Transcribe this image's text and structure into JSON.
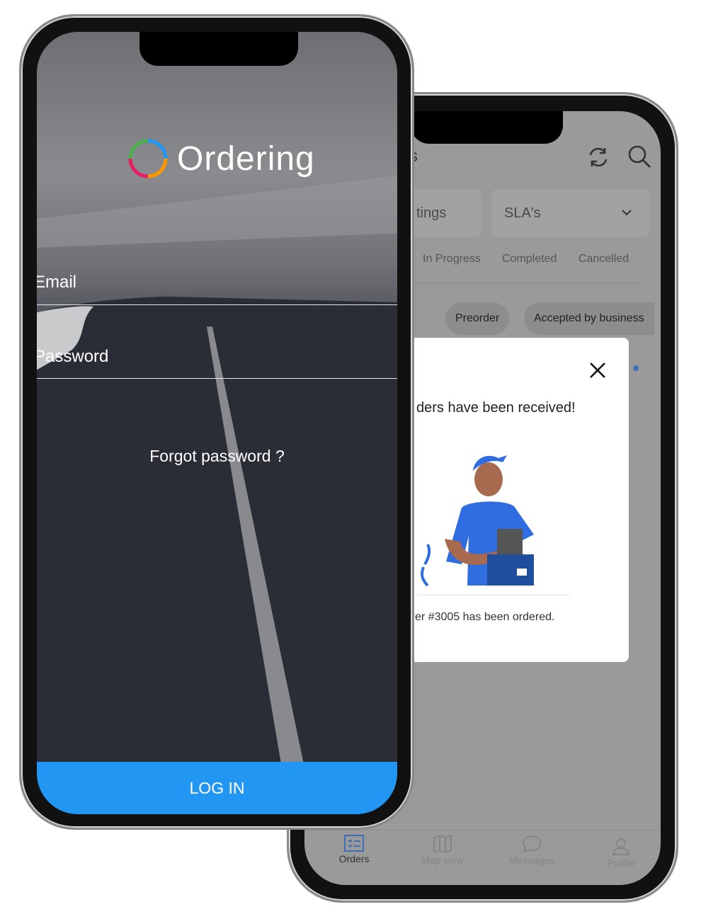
{
  "back_phone": {
    "header_fragment": "s",
    "filters": {
      "left_fragment": "tings",
      "sla_select": "SLA's"
    },
    "tabs": [
      "In Progress",
      "Completed",
      "Cancelled"
    ],
    "chips": [
      "Preorder",
      "Accepted by business"
    ],
    "modal": {
      "title": "ders have been received!",
      "message": "er #3005 has been ordered."
    },
    "bottom_nav": [
      {
        "label": "Orders",
        "icon": "orders-list-icon",
        "active": true
      },
      {
        "label": "Map view",
        "icon": "map-icon",
        "active": false
      },
      {
        "label": "Messages",
        "icon": "chat-bubble-icon",
        "active": false
      },
      {
        "label": "Profile",
        "icon": "user-icon",
        "active": false
      }
    ],
    "accent_color": "#3d6fb6"
  },
  "front_phone": {
    "logo_text": "Ordering",
    "email_label": "Email",
    "password_label": "Password",
    "forgot_password": "Forgot password ?",
    "login_button": "LOG IN",
    "login_color": "#2196f3"
  }
}
